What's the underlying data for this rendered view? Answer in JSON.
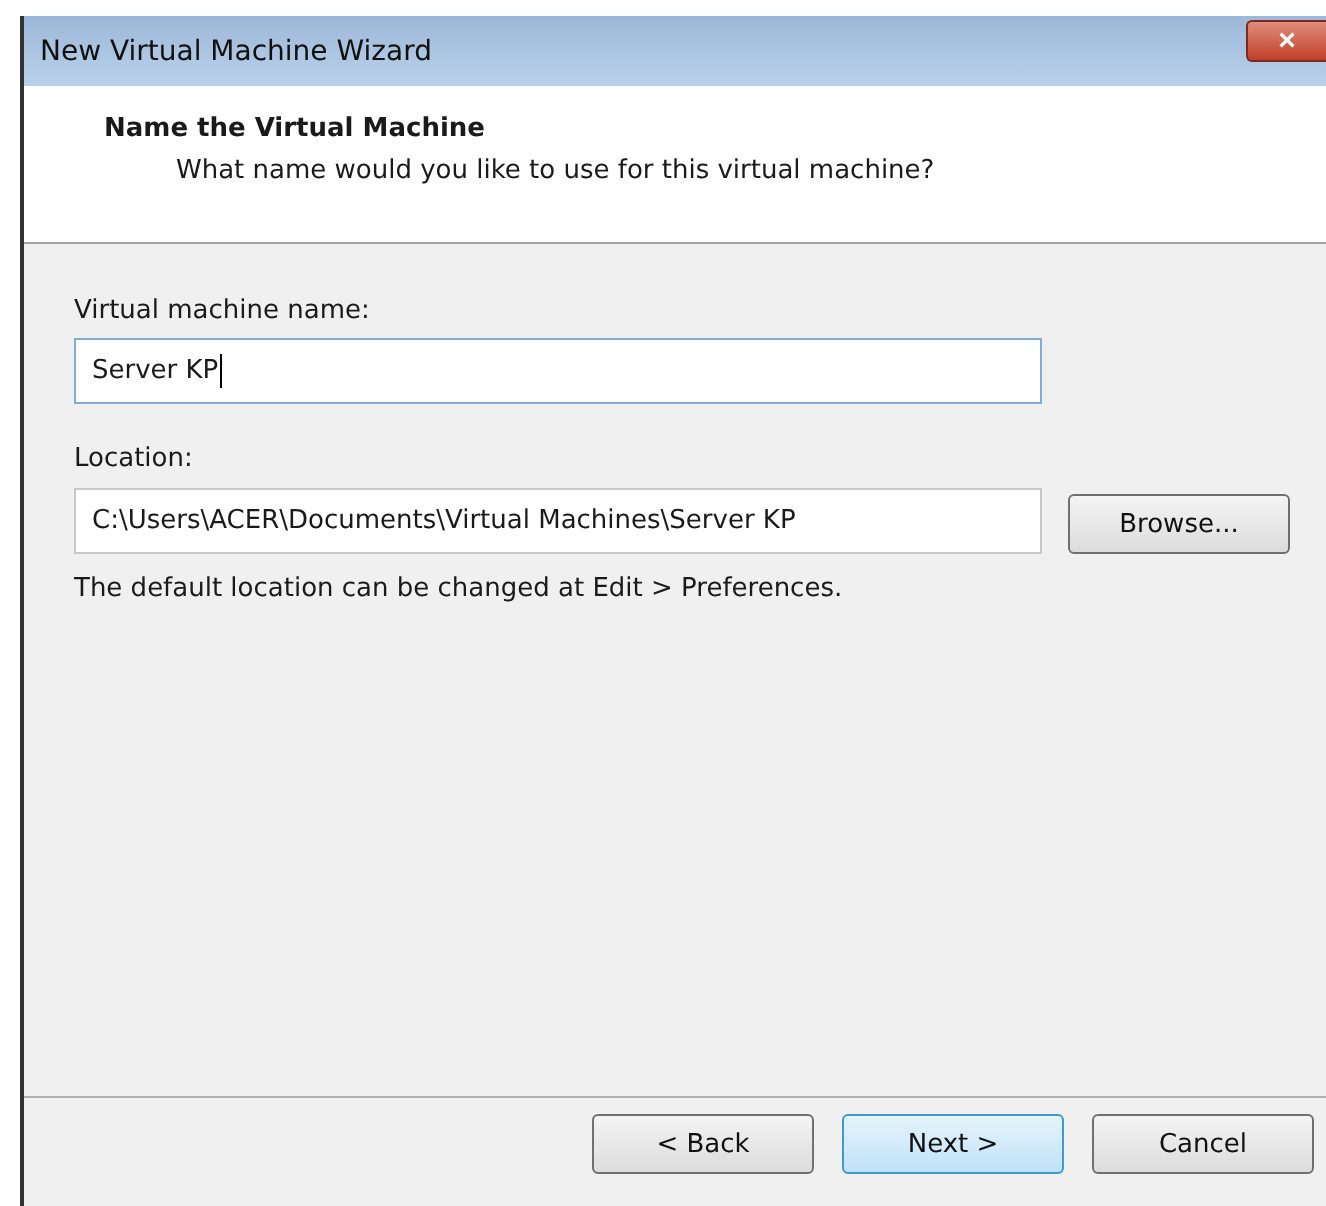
{
  "window": {
    "title": "New Virtual Machine Wizard",
    "close": "×"
  },
  "header": {
    "title": "Name the Virtual Machine",
    "subtitle": "What name would you like to use for this virtual machine?"
  },
  "name_field": {
    "label": "Virtual machine name:",
    "value": "Server KP",
    "focused": true
  },
  "location_field": {
    "label": "Location:",
    "value": "C:\\Users\\ACER\\Documents\\Virtual Machines\\Server KP",
    "button": "Browse..."
  },
  "note": "The default location can be changed at Edit > Preferences.",
  "buttons": [
    {
      "label": "< Back",
      "default": false
    },
    {
      "label": "Next >",
      "default": true
    },
    {
      "label": "Cancel",
      "default": false
    }
  ]
}
